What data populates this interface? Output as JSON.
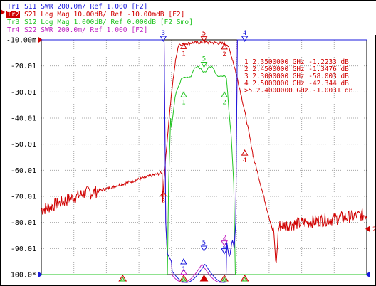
{
  "traces": [
    {
      "id": "Tr1",
      "param": "S11",
      "format": "SWR",
      "scale": "200.0m/",
      "ref": "Ref 1.000",
      "tag": "[F2]",
      "color": "#1a1adc",
      "active": false
    },
    {
      "id": "Tr2",
      "param": "S21",
      "format": "Log Mag",
      "scale": "10.00dB/",
      "ref": "Ref -10.00mdB",
      "tag": "[F2]",
      "color": "#d00000",
      "active": true
    },
    {
      "id": "Tr3",
      "param": "S12",
      "format": "Log Mag",
      "scale": "1.000dB/",
      "ref": "Ref 0.000dB",
      "tag": "[F2 Smo]",
      "color": "#22c422",
      "active": false
    },
    {
      "id": "Tr4",
      "param": "S22",
      "format": "SWR",
      "scale": "200.0m/",
      "ref": "Ref 1.000",
      "tag": "[F2]",
      "color": "#c020c0",
      "active": false
    }
  ],
  "y_axis": {
    "labels": [
      "-10.00m",
      "-20.01",
      "-30.01",
      "-40.01",
      "-50.01",
      "-60.01",
      "-70.01",
      "-80.01",
      "-90.01",
      "-100.0*"
    ]
  },
  "markers": [
    {
      "num": "1",
      "prefix": " ",
      "freq": "2.3500000 GHz",
      "value": "-1.2233 dB"
    },
    {
      "num": "2",
      "prefix": " ",
      "freq": "2.4500000 GHz",
      "value": "-1.3476 dB"
    },
    {
      "num": "3",
      "prefix": " ",
      "freq": "2.3000000 GHz",
      "value": "-58.003 dB"
    },
    {
      "num": "4",
      "prefix": " ",
      "freq": "2.5000000 GHz",
      "value": "-42.344 dB"
    },
    {
      "num": "5",
      "prefix": ">",
      "freq": "2.4000000 GHz",
      "value": "-1.0031 dB"
    }
  ],
  "right_ref_label": "2",
  "colors": {
    "grid": "#a8a8a8",
    "border": "#000000",
    "tr1": "#1a1adc",
    "tr2": "#d00000",
    "tr3": "#22c422",
    "tr4": "#c020c0"
  }
}
